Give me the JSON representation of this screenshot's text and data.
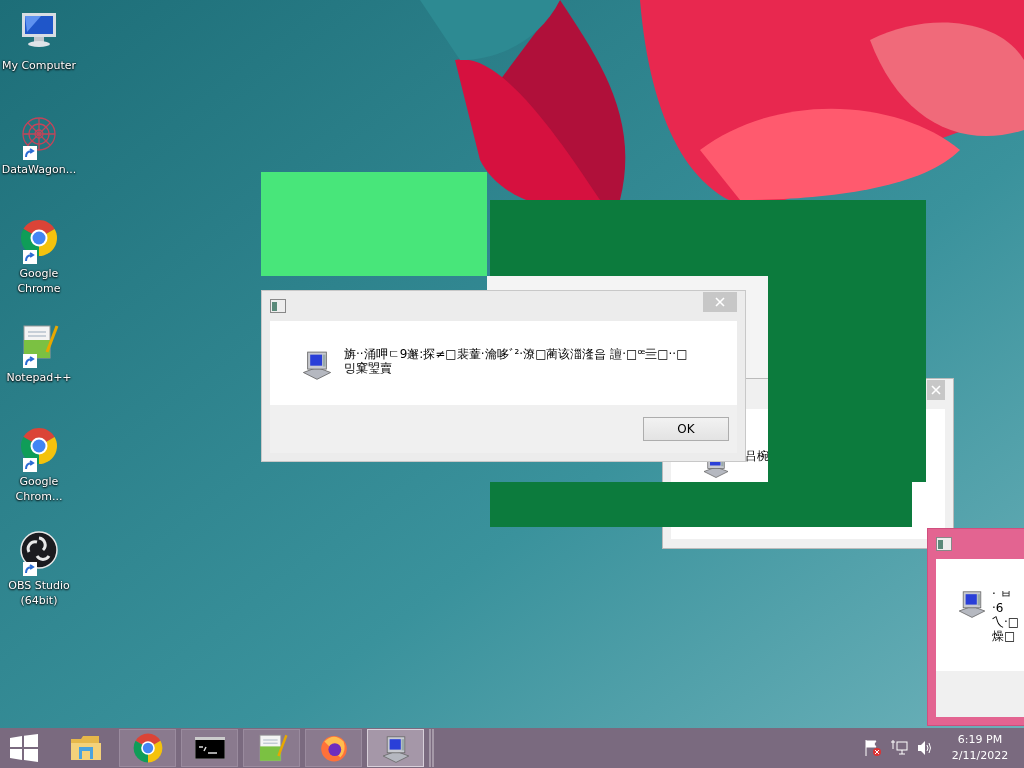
{
  "desktop_icons": [
    {
      "label": "My Computer",
      "kind": "computer"
    },
    {
      "label": "DataWagon...",
      "kind": "datawagon"
    },
    {
      "label": "Google Chrome",
      "kind": "chrome"
    },
    {
      "label": "Notepad++",
      "kind": "notepad"
    },
    {
      "label": "Google Chrom...",
      "kind": "chrome"
    },
    {
      "label": "OBS Studio (64bit)",
      "kind": "obs"
    }
  ],
  "main_dialog": {
    "message_lines": [
      "旃··涌呷ㄷ9邂꞉探≠□裴蕫·瀹哆ﾞ²·潦□蔺该湽湰읍 譠·□ꟹ亖□··□",
      "밍窠琞賣"
    ],
    "button": "OK"
  },
  "back_dialog": {
    "message": "吕椀"
  },
  "pink_dialog": {
    "message_lines": [
      "· ㅂ",
      "·6",
      "乀·□",
      "燥□"
    ]
  },
  "taskbar": {
    "items": [
      {
        "kind": "explorer",
        "active": false
      },
      {
        "kind": "chrome",
        "active": false
      },
      {
        "kind": "terminal",
        "active": false
      },
      {
        "kind": "notepad",
        "active": false
      },
      {
        "kind": "firefox",
        "active": false
      },
      {
        "kind": "msgbox",
        "active": true
      }
    ],
    "time": "6:19 PM",
    "date": "2/11/2022"
  }
}
